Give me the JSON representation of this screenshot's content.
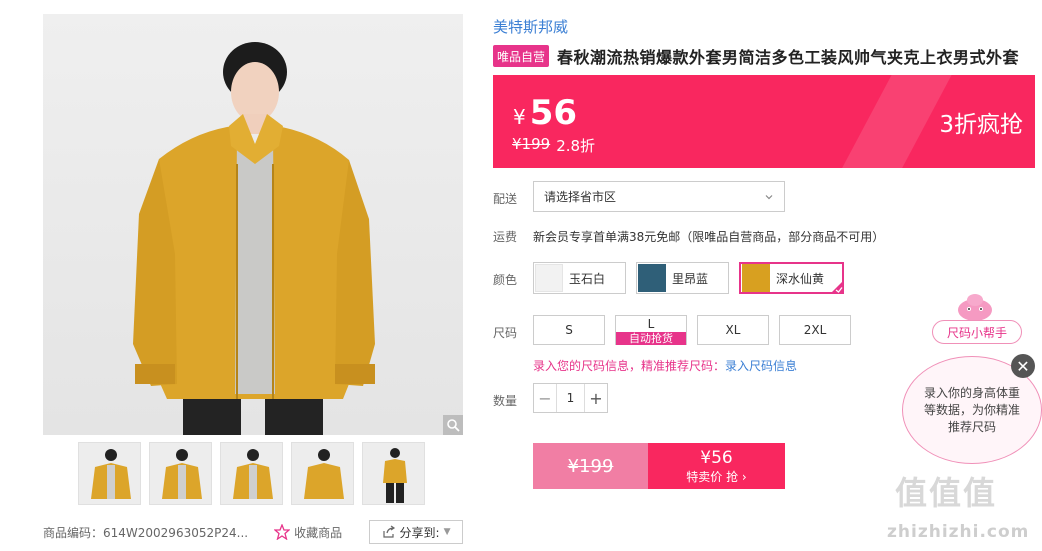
{
  "brand": "美特斯邦威",
  "self_badge": "唯品自营",
  "title": "春秋潮流热销爆款外套男简洁多色工装风帅气夹克上衣男式外套",
  "price": {
    "currency": "¥",
    "current": "56",
    "original": "¥199",
    "discount": "2.8折",
    "promo": "3折疯抢"
  },
  "shipping": {
    "label": "配送",
    "select_placeholder": "请选择省市区"
  },
  "freight": {
    "label": "运费",
    "text": "新会员专享首单满38元免邮（限唯品自营商品，部分商品不可用）"
  },
  "colors": {
    "label": "颜色",
    "options": [
      {
        "name": "玉石白",
        "swatch": "#f2f2f2"
      },
      {
        "name": "里昂蓝",
        "swatch": "#2f5f78"
      },
      {
        "name": "深水仙黄",
        "swatch": "#d8a020"
      }
    ],
    "selected": "深水仙黄"
  },
  "sizes": {
    "label": "尺码",
    "options": [
      "S",
      "L",
      "XL",
      "2XL"
    ],
    "auto_grab": "自动抢货",
    "hint_text": "录入您的尺码信息，精准推荐尺码：",
    "hint_link": "录入尺码信息"
  },
  "quantity": {
    "label": "数量",
    "value": "1",
    "minus": "−",
    "plus": "+"
  },
  "buy": {
    "orig": "¥199",
    "price": "¥56",
    "action": "特卖价 抢",
    "chevron": "›"
  },
  "gallery": {
    "thumb_count": 5,
    "zoom_icon": "magnifier-icon"
  },
  "meta": {
    "sku": "商品编码：614W2002963052P24...",
    "favorite": "收藏商品",
    "share": "分享到:"
  },
  "size_helper": {
    "tag": "尺码小帮手",
    "bubble": "录入你的身高体重等数据，为你精准推荐尺码",
    "close": "✕"
  },
  "watermark": {
    "glyphs": "值值值",
    "domain": "zhizhizhi.com"
  },
  "colors_theme": {
    "accent": "#f9275f",
    "pink": "#e7348a",
    "link": "#3b7fd4"
  }
}
